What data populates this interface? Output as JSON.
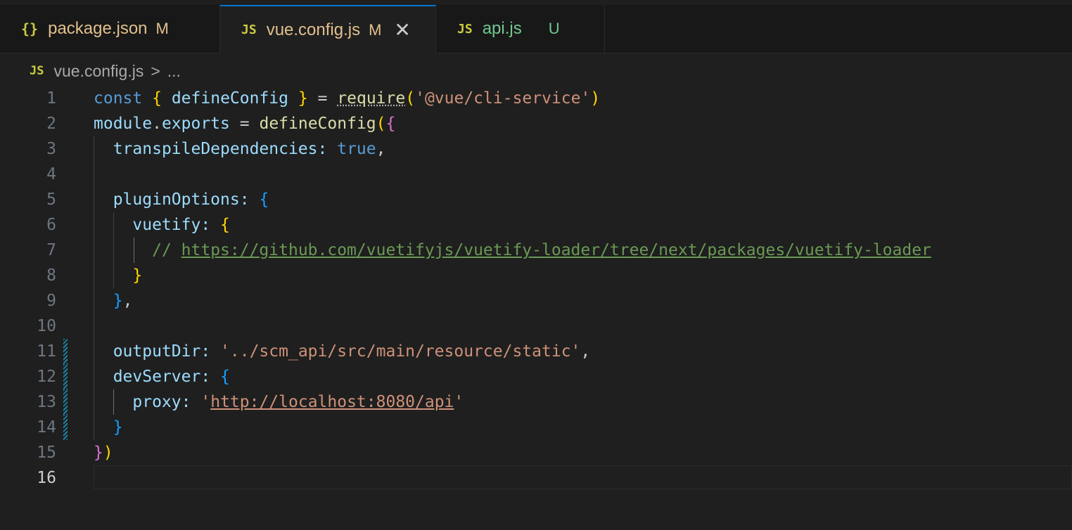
{
  "tabs": [
    {
      "icon": "{}",
      "name": "package.json",
      "status": "M"
    },
    {
      "icon": "JS",
      "name": "vue.config.js",
      "status": "M",
      "close": "✕"
    },
    {
      "icon": "JS",
      "name": "api.js",
      "status": "U"
    }
  ],
  "breadcrumb": {
    "icon": "JS",
    "file": "vue.config.js",
    "sep": ">",
    "more": "..."
  },
  "lines": [
    "1",
    "2",
    "3",
    "4",
    "5",
    "6",
    "7",
    "8",
    "9",
    "10",
    "11",
    "12",
    "13",
    "14",
    "15",
    "16"
  ],
  "code": {
    "l1": {
      "kw": "const",
      "b1o": "{",
      "ident": "defineConfig",
      "b1c": "}",
      "eq": "=",
      "req": "require",
      "po": "(",
      "str": "'@vue/cli-service'",
      "pc": ")"
    },
    "l2": {
      "mod": "module",
      "dot": ".",
      "exp": "exports",
      "eq": "=",
      "fn": "defineConfig",
      "po": "(",
      "bo": "{"
    },
    "l3": {
      "key": "transpileDependencies",
      "colon": ":",
      "val": "true",
      "comma": ","
    },
    "l5": {
      "key": "pluginOptions",
      "colon": ":",
      "bo": "{"
    },
    "l6": {
      "key": "vuetify",
      "colon": ":",
      "bo": "{"
    },
    "l7": {
      "slashes": "//",
      "url": "https://github.com/vuetifyjs/vuetify-loader/tree/next/packages/vuetify-loader"
    },
    "l8": {
      "bc": "}"
    },
    "l9": {
      "bc": "}",
      "comma": ","
    },
    "l11": {
      "key": "outputDir",
      "colon": ":",
      "str": "'../scm_api/src/main/resource/static'",
      "comma": ","
    },
    "l12": {
      "key": "devServer",
      "colon": ":",
      "bo": "{"
    },
    "l13": {
      "key": "proxy",
      "colon": ":",
      "q1": "'",
      "url": "http://localhost:8080/api",
      "q2": "'"
    },
    "l14": {
      "bc": "}"
    },
    "l15": {
      "bc": "}",
      "pc": ")"
    }
  },
  "colors": {
    "accent": "#0078d4",
    "modified": "#e2c08d",
    "untracked": "#73c991",
    "background": "#1f1f1f"
  }
}
